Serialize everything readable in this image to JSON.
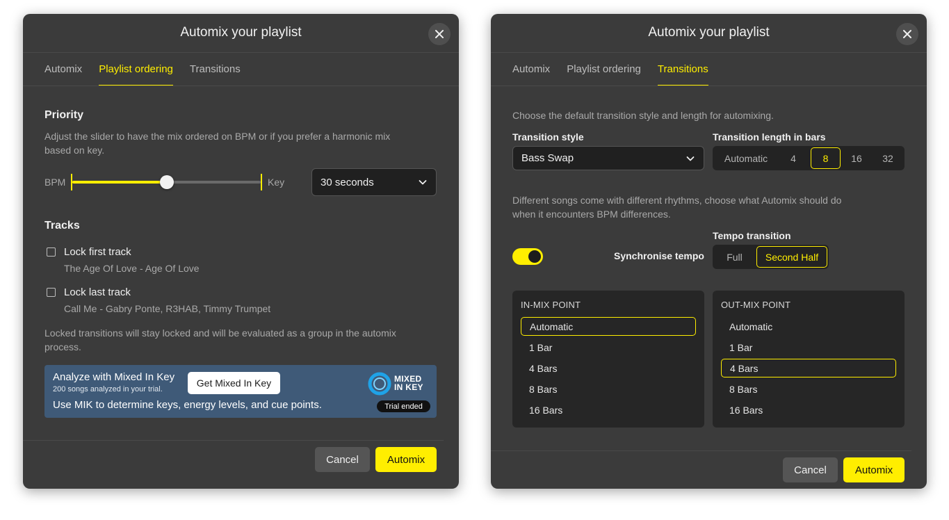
{
  "left": {
    "title": "Automix your playlist",
    "tabs": [
      "Automix",
      "Playlist ordering",
      "Transitions"
    ],
    "active_tab": 1,
    "priority": {
      "heading": "Priority",
      "description_line1": "Adjust the slider to have the mix ordered on BPM or if you prefer a harmonic mix",
      "description_line2": "based on key.",
      "left_label": "BPM",
      "right_label": "Key",
      "slider_fraction": 0.5,
      "duration_select": "30 seconds"
    },
    "tracks": {
      "heading": "Tracks",
      "items": [
        {
          "label": "Lock first track",
          "sub": "The Age Of Love - Age Of Love"
        },
        {
          "label": "Lock last track",
          "sub": "Call Me - Gabry Ponte, R3HAB, Timmy Trumpet"
        }
      ],
      "note_line1": "Locked transitions will stay locked and will be evaluated as a group in the automix",
      "note_line2": "process."
    },
    "mik": {
      "title": "Analyze with Mixed In Key",
      "subtitle": "200 songs analyzed in your trial.",
      "body": "Use MIK to determine keys, energy levels, and cue points.",
      "button": "Get Mixed In Key",
      "logo_line1": "MIXED",
      "logo_line2": "IN KEY",
      "badge": "Trial ended"
    },
    "footer": {
      "cancel": "Cancel",
      "primary": "Automix"
    }
  },
  "right": {
    "title": "Automix your playlist",
    "tabs": [
      "Automix",
      "Playlist ordering",
      "Transitions"
    ],
    "active_tab": 2,
    "intro": "Choose the default transition style and length for automixing.",
    "style_label": "Transition style",
    "style_value": "Bass Swap",
    "length_label": "Transition length in bars",
    "length_options": [
      "Automatic",
      "4",
      "8",
      "16",
      "32"
    ],
    "length_active": "8",
    "rhythm_line1": "Different songs come with different rhythms, choose what Automix should do",
    "rhythm_line2": "when it encounters BPM differences.",
    "sync_label": "Synchronise tempo",
    "sync_on": true,
    "tempo_label": "Tempo transition",
    "tempo_options": [
      "Full",
      "Second Half"
    ],
    "tempo_active": "Second Half",
    "in_mix": {
      "title": "IN-MIX POINT",
      "options": [
        "Automatic",
        "1 Bar",
        "4 Bars",
        "8 Bars",
        "16 Bars"
      ],
      "active": "Automatic"
    },
    "out_mix": {
      "title": "OUT-MIX POINT",
      "options": [
        "Automatic",
        "1 Bar",
        "4 Bars",
        "8 Bars",
        "16 Bars"
      ],
      "active": "4 Bars"
    },
    "footer": {
      "cancel": "Cancel",
      "primary": "Automix"
    }
  },
  "colors": {
    "accent": "#ffee00",
    "dialog_bg": "#3b3b3b",
    "mik_card": "#3f5a78"
  },
  "icons": {
    "close": "close-icon",
    "dropdown": "chevron-down-icon",
    "logo": "mixed-in-key-logo"
  }
}
